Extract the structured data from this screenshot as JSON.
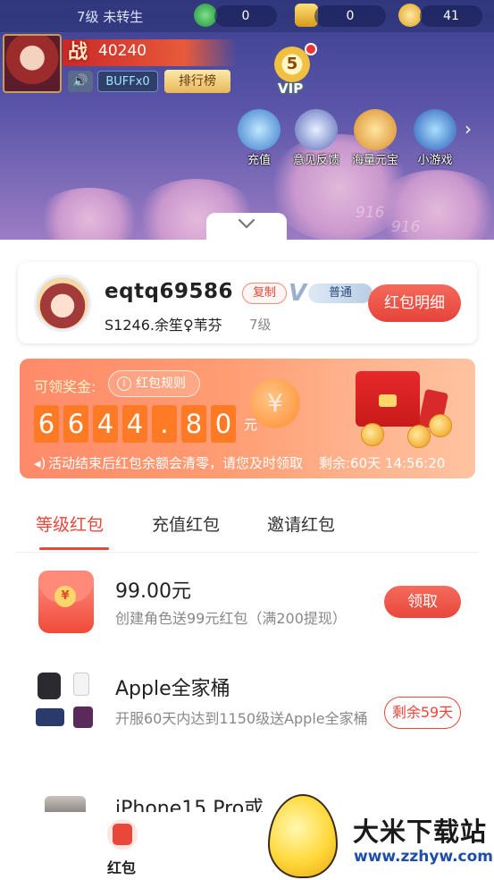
{
  "game": {
    "level_text": "7级 未转生",
    "resources": [
      {
        "name": "jade",
        "value": "0"
      },
      {
        "name": "gold-ingot",
        "value": "0"
      },
      {
        "name": "coin",
        "value": "41"
      }
    ],
    "power_char": "战",
    "power_value": "40240",
    "buff_label": "BUFFx0",
    "rank_label": "排行榜",
    "vip_level": "5",
    "vip_label": "VIP",
    "features": [
      {
        "label": "充值",
        "icon": "recharge-icon"
      },
      {
        "label": "意见反馈",
        "icon": "feedback-icon"
      },
      {
        "label": "海量元宝",
        "icon": "treasure-icon"
      },
      {
        "label": "小游戏",
        "icon": "minigame-icon"
      }
    ],
    "watermark_1": "916",
    "watermark_2": "916"
  },
  "user": {
    "name": "eqtq69586",
    "copy_label": "复制",
    "tier_label": "普通",
    "server_role": "S1246.余笙♀苇芬",
    "level": "7级",
    "detail_button": "红包明细"
  },
  "prize": {
    "label": "可领奖金:",
    "rule_label": "红包规则",
    "amount_digits": [
      "6",
      "6",
      "4",
      "4",
      ".",
      "8",
      "0"
    ],
    "unit": "元",
    "notice": "活动结束后红包余额会清零，请您及时领取",
    "countdown": "剩余:60天 14:56:20"
  },
  "tabs": [
    {
      "label": "等级红包",
      "active": true
    },
    {
      "label": "充值红包",
      "active": false
    },
    {
      "label": "邀请红包",
      "active": false
    }
  ],
  "items": [
    {
      "title": "99.00元",
      "subtitle": "创建角色送99元红包（满200提现）",
      "action": "领取"
    },
    {
      "title": "Apple全家桶",
      "subtitle": "开服60天内达到1150级送Apple全家桶",
      "action": "剩余59天"
    },
    {
      "title": "iPhone15 Pro或"
    }
  ],
  "bottom_nav": {
    "label": "红包"
  },
  "watermark": {
    "name": "大米下载站",
    "url": "www.zzhyw.com"
  },
  "colors": {
    "accent": "#e8473a",
    "prize_bg": "#ff9c72",
    "digit_bg": "#ff7a24"
  }
}
